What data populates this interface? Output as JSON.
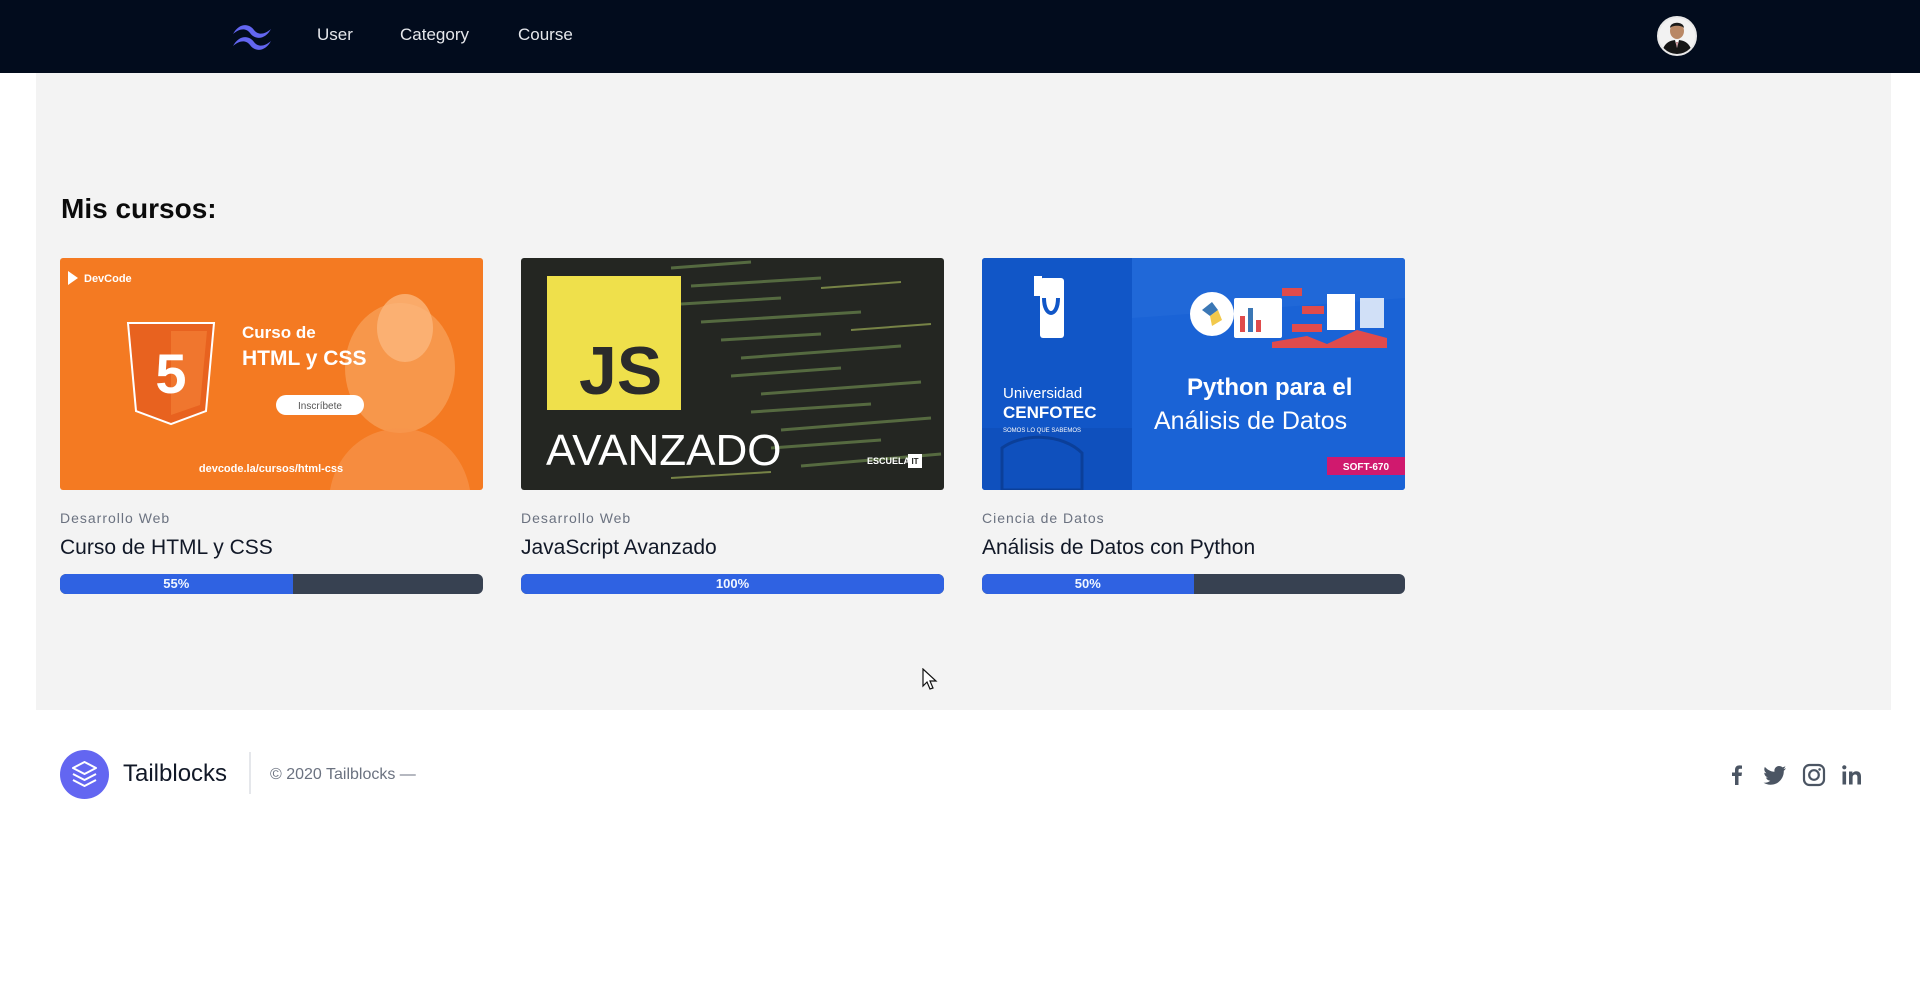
{
  "nav": {
    "logo_icon": "tailwind-logo-icon",
    "links": [
      "User",
      "Category",
      "Course"
    ],
    "avatar_icon": "user-avatar"
  },
  "main": {
    "section_title": "Mis cursos:",
    "courses": [
      {
        "category": "Desarrollo Web",
        "title": "Curso de HTML y CSS",
        "progress": 55,
        "progress_label": "55%",
        "thumb": {
          "brand": "DevCode",
          "heading1": "Curso de",
          "heading2": "HTML y CSS",
          "button": "Inscríbete",
          "url": "devcode.la/cursos/html-css",
          "color": "#f47a22"
        }
      },
      {
        "category": "Desarrollo Web",
        "title": "JavaScript Avanzado",
        "progress": 100,
        "progress_label": "100%",
        "thumb": {
          "badge": "JS",
          "heading": "AVANZADO",
          "brand": "ESCUELA",
          "brand_box": "IT",
          "color": "#2a2a2a"
        }
      },
      {
        "category": "Ciencia de Datos",
        "title": "Análisis de Datos con Python",
        "progress": 50,
        "progress_label": "50%",
        "thumb": {
          "uni1": "Universidad",
          "uni2": "CENFOTEC",
          "uni_tag": "SOMOS LO QUE SABEMOS",
          "heading1": "Python para el",
          "heading2": "Análisis de Datos",
          "code": "SOFT-670",
          "color": "#1a63d6"
        }
      }
    ]
  },
  "footer": {
    "logo_icon": "stack-logo-icon",
    "brand": "Tailblocks",
    "copyright": "© 2020 Tailblocks —",
    "social_icons": [
      "facebook-icon",
      "twitter-icon",
      "instagram-icon",
      "linkedin-icon"
    ]
  },
  "colors": {
    "nav_bg": "#020c1d",
    "main_bg": "#f3f3f3",
    "progress_track": "#374151",
    "progress_fill": "#2f62e2",
    "footer_logo": "#6366f1"
  }
}
